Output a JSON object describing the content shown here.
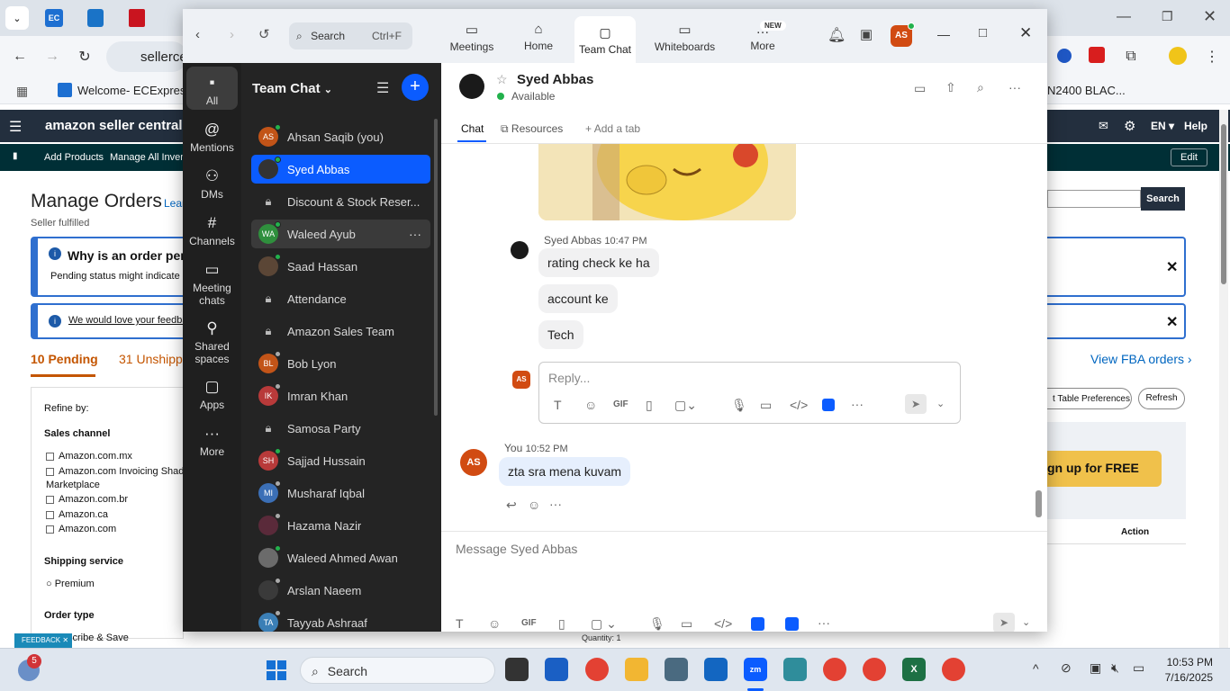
{
  "browser": {
    "address": "sellerce",
    "bookmarks": [
      "Welcome- ECExpres...",
      "N2400 BLAC..."
    ]
  },
  "amazon": {
    "logo": "amazon seller central",
    "lang": "EN",
    "help": "Help",
    "nav_add": "Add Products",
    "nav_manage": "Manage All Invent",
    "edit": "Edit",
    "page_title": "Manage Orders",
    "learn": "Lear",
    "subtitle": "Seller fulfilled",
    "alert1_title": "Why is an order pen",
    "alert1_text": "Pending status might indicate a",
    "alert2_text": "We would love your feedba",
    "tab_pending": "10 Pending",
    "tab_unshipped": "31 Unshippe",
    "refine": "Refine by:",
    "sales_channel": "Sales channel",
    "channels": [
      "Amazon.com.mx",
      "Amazon.com Invoicing Shado",
      "Marketplace",
      "Amazon.com.br",
      "Amazon.ca",
      "Amazon.com"
    ],
    "shipping_service": "Shipping service",
    "premium": "Premium",
    "order_type": "Order type",
    "subscribe": "scribe & Save",
    "search_btn": "Search",
    "view_fba": "View FBA orders",
    "table_prefs": "t Table Preferences",
    "refresh": "Refresh",
    "signup": "gn up for FREE",
    "action": "Action",
    "quantity": "Quantity: 1",
    "feedback": "FEEDBACK"
  },
  "zoom": {
    "search_placeholder": "Search",
    "search_shortcut": "Ctrl+F",
    "top_tabs": [
      "Meetings",
      "Home",
      "Team Chat",
      "Whiteboards",
      "More"
    ],
    "new_badge": "NEW",
    "user_initials": "AS",
    "rail": [
      "All",
      "Mentions",
      "DMs",
      "Channels",
      "Meeting chats",
      "Shared spaces",
      "Apps",
      "More"
    ],
    "list_title": "Team Chat",
    "contacts": [
      {
        "initials": "AS",
        "name": "Ahsan Saqib (you)",
        "color": "#c25418"
      },
      {
        "initials": "",
        "name": "Syed Abbas",
        "color": "#333333"
      },
      {
        "initials": "",
        "name": "Discount & Stock Reser...",
        "color": ""
      },
      {
        "initials": "WA",
        "name": "Waleed Ayub",
        "color": "#2f8f3d"
      },
      {
        "initials": "",
        "name": "Saad Hassan",
        "color": "#5b4636"
      },
      {
        "initials": "",
        "name": "Attendance",
        "color": ""
      },
      {
        "initials": "",
        "name": "Amazon Sales Team",
        "color": ""
      },
      {
        "initials": "BL",
        "name": "Bob Lyon",
        "color": "#c25418"
      },
      {
        "initials": "IK",
        "name": "Imran Khan",
        "color": "#b83a3a"
      },
      {
        "initials": "",
        "name": "Samosa Party",
        "color": ""
      },
      {
        "initials": "SH",
        "name": "Sajjad Hussain",
        "color": "#b83a3a"
      },
      {
        "initials": "MI",
        "name": "Musharaf Iqbal",
        "color": "#3b6fb6"
      },
      {
        "initials": "",
        "name": "Hazama Nazir",
        "color": "#5a2a3a"
      },
      {
        "initials": "",
        "name": "Waleed Ahmed Awan",
        "color": "#6b6b6b"
      },
      {
        "initials": "",
        "name": "Arslan Naeem",
        "color": "#3a3a3a"
      },
      {
        "initials": "TA",
        "name": "Tayyab Ashraaf",
        "color": "#3b7fb6"
      }
    ],
    "chat": {
      "name": "Syed Abbas",
      "status": "Available",
      "tabs": [
        "Chat",
        "Resources",
        "Add a tab"
      ],
      "sender": "Syed Abbas",
      "sender_time": "10:47 PM",
      "messages": [
        "rating check ke ha",
        "account ke",
        "Tech"
      ],
      "reply_placeholder": "Reply...",
      "you_label": "You",
      "you_time": "10:52 PM",
      "you_message": "zta sra mena kuvam",
      "composer_placeholder": "Message Syed Abbas"
    }
  },
  "taskbar": {
    "search": "Search",
    "time": "10:53 PM",
    "date": "7/16/2025",
    "badge": "5"
  }
}
